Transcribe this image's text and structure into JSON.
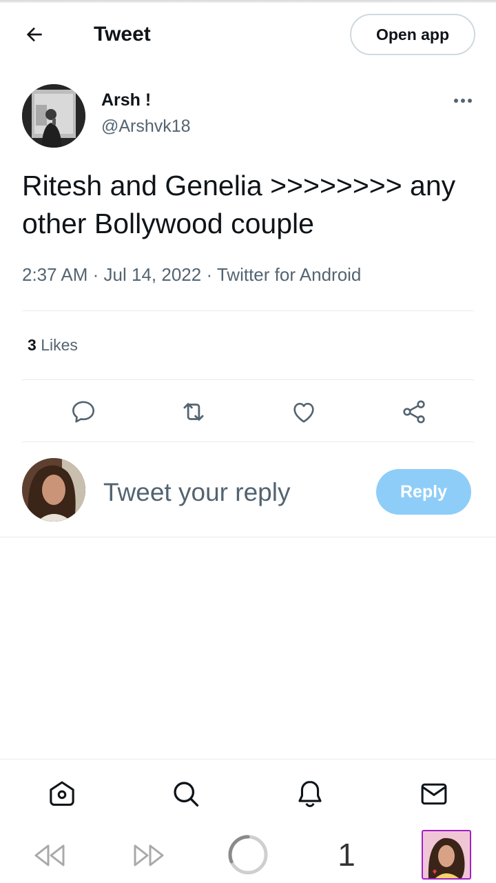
{
  "header": {
    "title": "Tweet",
    "open_app_label": "Open app"
  },
  "tweet": {
    "author_name": "Arsh !",
    "author_handle": "@Arshvk18",
    "text": "Ritesh and Genelia >>>>>>>> any other Bollywood couple",
    "time": "2:37 AM",
    "date": "Jul 14, 2022",
    "source": "Twitter for Android",
    "likes_count": "3",
    "likes_label": "Likes"
  },
  "reply": {
    "placeholder": "Tweet your reply",
    "button_label": "Reply"
  },
  "browser": {
    "tab_count": "1"
  },
  "colors": {
    "accent_disabled": "#8ecdf8",
    "secondary_text": "#536471",
    "primary_text": "#0f1419",
    "thumb_border": "#a020c8"
  },
  "icons": {
    "back": "arrow-left-icon",
    "more": "more-horizontal-icon",
    "reply": "comment-icon",
    "retweet": "retweet-icon",
    "like": "heart-icon",
    "share": "share-icon",
    "home": "home-icon",
    "search": "search-icon",
    "notifications": "bell-icon",
    "messages": "mail-icon"
  }
}
